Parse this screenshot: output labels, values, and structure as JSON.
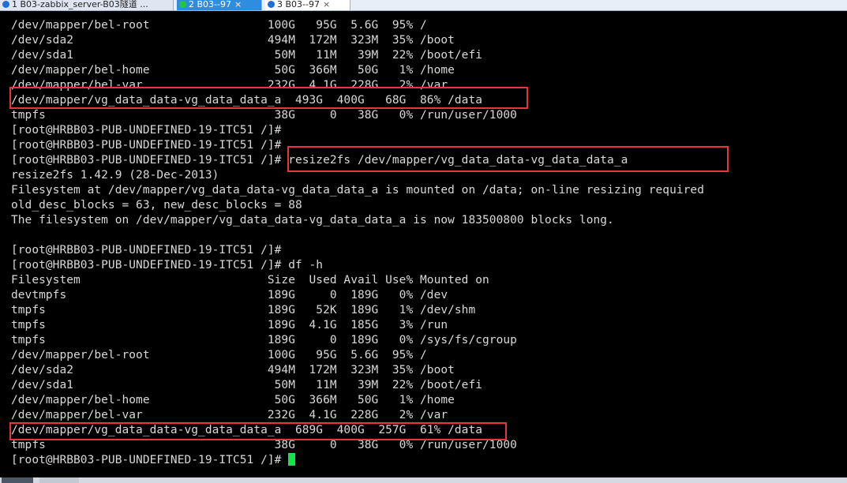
{
  "tabs": [
    {
      "label": "1 B03-zabbix_server-B03隧道 ...",
      "status": "warning-icon"
    },
    {
      "label": "2 B03--97",
      "status": "connected-icon",
      "close": "×"
    },
    {
      "label": "3 B03--97",
      "status": "warning-icon",
      "close": "×"
    }
  ],
  "terminal": {
    "lines": [
      "/dev/mapper/bel-root                 100G   95G  5.6G  95% /",
      "/dev/sda2                            494M  172M  323M  35% /boot",
      "/dev/sda1                             50M   11M   39M  22% /boot/efi",
      "/dev/mapper/bel-home                  50G  366M   50G   1% /home",
      "/dev/mapper/bel-var                  232G  4.1G  228G   2% /var",
      "/dev/mapper/vg_data_data-vg_data_data_a  493G  400G   68G  86% /data",
      "tmpfs                                 38G     0   38G   0% /run/user/1000",
      "[root@HRBB03-PUB-UNDEFINED-19-ITC51 /]#",
      "[root@HRBB03-PUB-UNDEFINED-19-ITC51 /]#",
      "[root@HRBB03-PUB-UNDEFINED-19-ITC51 /]# resize2fs /dev/mapper/vg_data_data-vg_data_data_a",
      "resize2fs 1.42.9 (28-Dec-2013)",
      "Filesystem at /dev/mapper/vg_data_data-vg_data_data_a is mounted on /data; on-line resizing required",
      "old_desc_blocks = 63, new_desc_blocks = 88",
      "The filesystem on /dev/mapper/vg_data_data-vg_data_data_a is now 183500800 blocks long.",
      "",
      "[root@HRBB03-PUB-UNDEFINED-19-ITC51 /]#",
      "[root@HRBB03-PUB-UNDEFINED-19-ITC51 /]# df -h",
      "Filesystem                           Size  Used Avail Use% Mounted on",
      "devtmpfs                             189G     0  189G   0% /dev",
      "tmpfs                                189G   52K  189G   1% /dev/shm",
      "tmpfs                                189G  4.1G  185G   3% /run",
      "tmpfs                                189G     0  189G   0% /sys/fs/cgroup",
      "/dev/mapper/bel-root                 100G   95G  5.6G  95% /",
      "/dev/sda2                            494M  172M  323M  35% /boot",
      "/dev/sda1                             50M   11M   39M  22% /boot/efi",
      "/dev/mapper/bel-home                  50G  366M   50G   1% /home",
      "/dev/mapper/bel-var                  232G  4.1G  228G   2% /var",
      "/dev/mapper/vg_data_data-vg_data_data_a  689G  400G  257G  61% /data",
      "tmpfs                                 38G     0   38G   0% /run/user/1000"
    ],
    "prompt": "[root@HRBB03-PUB-UNDEFINED-19-ITC51 /]# "
  },
  "colors": {
    "background": "#000000",
    "text": "#d8d8d8",
    "highlight": "#e5363f",
    "cursor": "#17e04a",
    "active_tab": "#2f8de0"
  }
}
